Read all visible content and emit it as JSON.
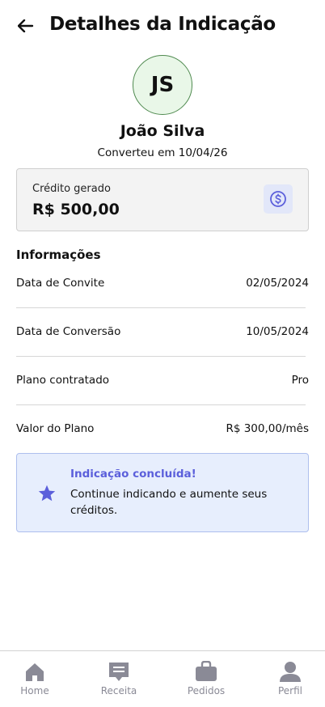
{
  "header": {
    "title": "Detalhes da Indicação",
    "back_icon": "arrow-left-icon"
  },
  "profile": {
    "initials": "JS",
    "name": "João Silva",
    "converted_text": "Converteu em 10/04/26",
    "avatar_bg": "#e9f7e8",
    "avatar_border": "#4f8a4f"
  },
  "credit": {
    "label": "Crédito gerado",
    "value": "R$ 500,00",
    "icon": "dollar-coin-icon",
    "icon_color": "#5b5fdb"
  },
  "info": {
    "title": "Informações",
    "rows": [
      {
        "label": "Data de Convite",
        "value": "02/05/2024"
      },
      {
        "label": "Data de Conversão",
        "value": "10/05/2024"
      },
      {
        "label": "Plano contratado",
        "value": "Pro"
      },
      {
        "label": "Valor do Plano",
        "value": "R$ 300,00/mês"
      }
    ]
  },
  "notice": {
    "title": "Indicação concluída!",
    "text": "Continue indicando e aumente seus créditos.",
    "icon": "star-icon",
    "accent": "#5b5fdb"
  },
  "tabs": [
    {
      "label": "Home",
      "icon": "home-icon"
    },
    {
      "label": "Receita",
      "icon": "receipt-icon"
    },
    {
      "label": "Pedidos",
      "icon": "shopping-bag-icon"
    },
    {
      "label": "Perfil",
      "icon": "user-icon"
    }
  ]
}
